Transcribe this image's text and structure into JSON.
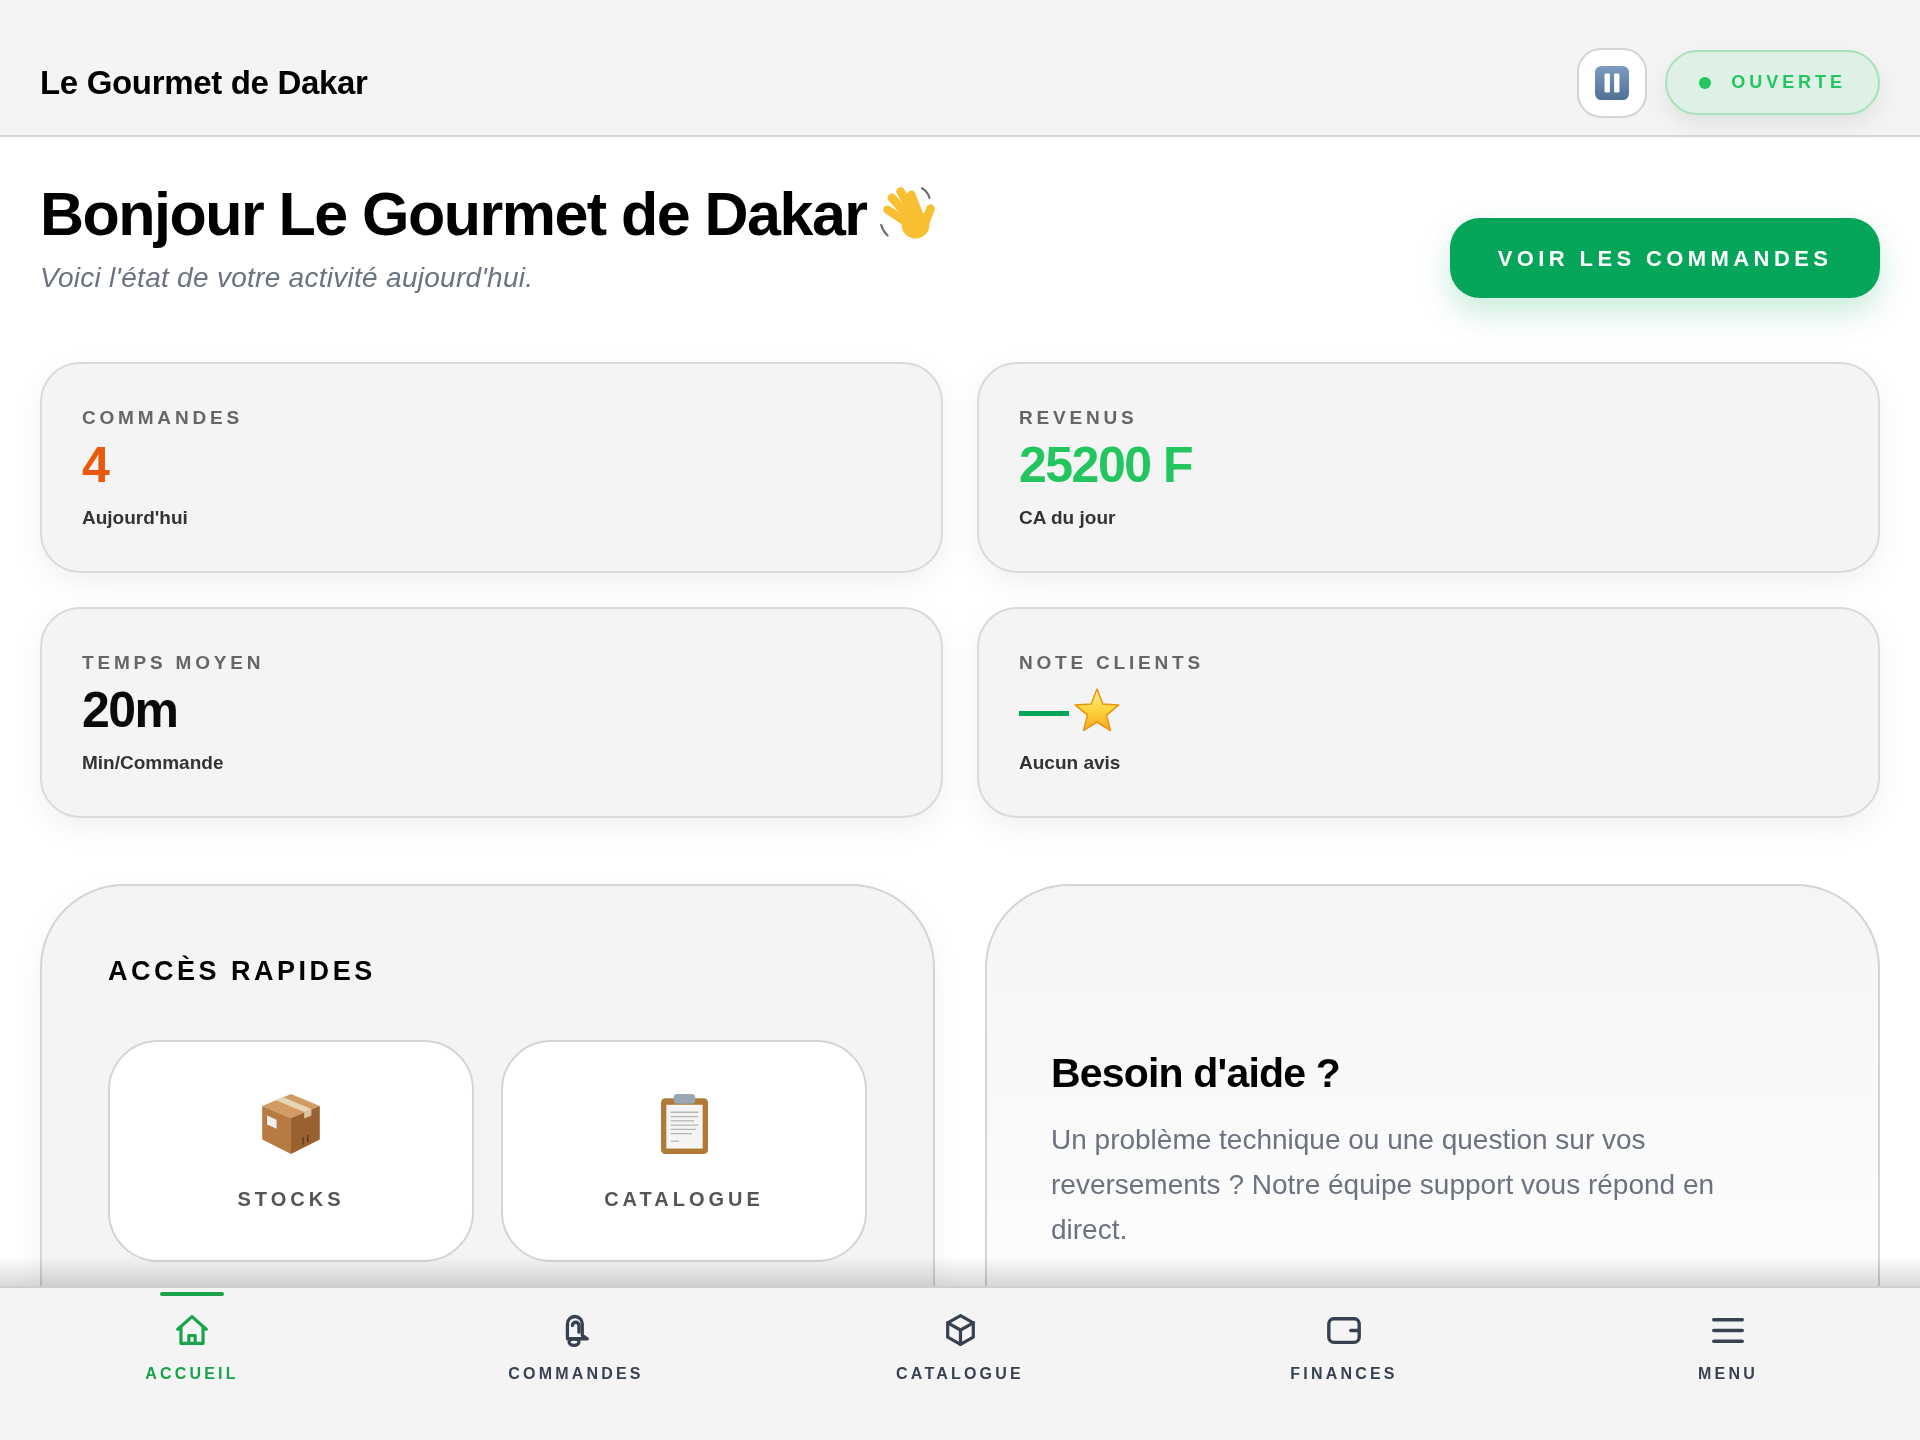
{
  "header": {
    "title": "Le Gourmet de Dakar",
    "status": {
      "label": "OUVERTE",
      "open": true
    }
  },
  "greeting": {
    "title": "Bonjour Le Gourmet de Dakar",
    "subtitle": "Voici l'état de votre activité aujourd'hui."
  },
  "primary_action": {
    "label": "VOIR LES COMMANDES"
  },
  "stats": [
    {
      "label": "COMMANDES",
      "value": "4",
      "caption": "Aujourd'hui",
      "color": "#ea580c",
      "kind": "value"
    },
    {
      "label": "REVENUS",
      "value": "25200 F",
      "caption": "CA du jour",
      "color": "#22c55e",
      "kind": "value"
    },
    {
      "label": "TEMPS MOYEN",
      "value": "20m",
      "caption": "Min/Commande",
      "color": "#0a0a0a",
      "kind": "value"
    },
    {
      "label": "NOTE CLIENTS",
      "value": "—",
      "caption": "Aucun avis",
      "color": "#05a55a",
      "kind": "rating"
    }
  ],
  "quick_access": {
    "title": "ACCÈS RAPIDES",
    "items": [
      {
        "label": "STOCKS"
      },
      {
        "label": "CATALOGUE"
      }
    ]
  },
  "help": {
    "title": "Besoin d'aide ?",
    "text": "Un problème technique ou une question sur vos reversements ? Notre équipe support vous répond en direct."
  },
  "bottom_nav": [
    {
      "label": "ACCUEIL",
      "selected": true
    },
    {
      "label": "COMMANDES",
      "selected": false
    },
    {
      "label": "CATALOGUE",
      "selected": false
    },
    {
      "label": "FINANCES",
      "selected": false
    },
    {
      "label": "MENU",
      "selected": false
    }
  ]
}
